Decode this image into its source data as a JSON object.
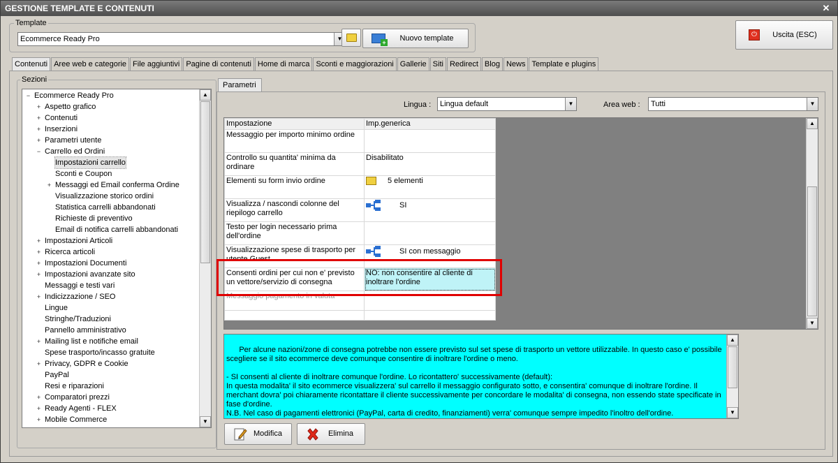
{
  "window": {
    "title": "GESTIONE TEMPLATE E CONTENUTI",
    "close": "✕"
  },
  "template": {
    "legend": "Template",
    "selected": "Ecommerce Ready Pro",
    "new_button": "Nuovo template"
  },
  "exit_button": "Uscita (ESC)",
  "tabs": [
    "Contenuti",
    "Aree web e categorie",
    "File aggiuntivi",
    "Pagine di contenuti",
    "Home di marca",
    "Sconti e maggiorazioni",
    "Gallerie",
    "Siti",
    "Redirect",
    "Blog",
    "News",
    "Template e plugins"
  ],
  "sections": {
    "legend": "Sezioni",
    "items": [
      {
        "label": "Ecommerce Ready Pro",
        "level": 0,
        "exp": "−"
      },
      {
        "label": "Aspetto grafico",
        "level": 1,
        "exp": "+"
      },
      {
        "label": "Contenuti",
        "level": 1,
        "exp": "+"
      },
      {
        "label": "Inserzioni",
        "level": 1,
        "exp": "+"
      },
      {
        "label": "Parametri utente",
        "level": 1,
        "exp": "+"
      },
      {
        "label": "Carrello ed Ordini",
        "level": 1,
        "exp": "−"
      },
      {
        "label": "Impostazioni carrello",
        "level": 2,
        "exp": "",
        "selected": true
      },
      {
        "label": "Sconti e Coupon",
        "level": 2,
        "exp": ""
      },
      {
        "label": "Messaggi ed Email conferma Ordine",
        "level": 2,
        "exp": "+"
      },
      {
        "label": "Visualizzazione storico ordini",
        "level": 2,
        "exp": ""
      },
      {
        "label": "Statistica carrelli abbandonati",
        "level": 2,
        "exp": ""
      },
      {
        "label": "Richieste di preventivo",
        "level": 2,
        "exp": ""
      },
      {
        "label": "Email di notifica carrelli abbandonati",
        "level": 2,
        "exp": ""
      },
      {
        "label": "Impostazioni Articoli",
        "level": 1,
        "exp": "+"
      },
      {
        "label": "Ricerca articoli",
        "level": 1,
        "exp": "+"
      },
      {
        "label": "Impostazioni Documenti",
        "level": 1,
        "exp": "+"
      },
      {
        "label": "Impostazioni avanzate sito",
        "level": 1,
        "exp": "+"
      },
      {
        "label": "Messaggi e testi vari",
        "level": 1,
        "exp": ""
      },
      {
        "label": "Indicizzazione / SEO",
        "level": 1,
        "exp": "+"
      },
      {
        "label": "Lingue",
        "level": 1,
        "exp": ""
      },
      {
        "label": "Stringhe/Traduzioni",
        "level": 1,
        "exp": ""
      },
      {
        "label": "Pannello amministrativo",
        "level": 1,
        "exp": ""
      },
      {
        "label": "Mailing list e notifiche email",
        "level": 1,
        "exp": "+"
      },
      {
        "label": "Spese trasporto/incasso gratuite",
        "level": 1,
        "exp": ""
      },
      {
        "label": "Privacy, GDPR e Cookie",
        "level": 1,
        "exp": "+"
      },
      {
        "label": "PayPal",
        "level": 1,
        "exp": ""
      },
      {
        "label": "Resi e riparazioni",
        "level": 1,
        "exp": ""
      },
      {
        "label": "Comparatori prezzi",
        "level": 1,
        "exp": "+"
      },
      {
        "label": "Ready Agenti - FLEX",
        "level": 1,
        "exp": "+"
      },
      {
        "label": "Mobile Commerce",
        "level": 1,
        "exp": "+"
      }
    ]
  },
  "params": {
    "tab": "Parametri",
    "lingua_label": "Lingua :",
    "lingua_value": "Lingua default",
    "area_label": "Area web :",
    "area_value": "Tutti",
    "headers": [
      "Impostazione",
      "Imp.generica"
    ],
    "rows": [
      {
        "name": "Messaggio per importo minimo ordine",
        "value": "",
        "icon": "",
        "h": 33
      },
      {
        "name": "Controllo su quantita' minima da ordinare",
        "value": "Disabilitato",
        "icon": "",
        "h": 33
      },
      {
        "name": "Elementi su form invio ordine",
        "value": "5 elementi",
        "icon": "folder",
        "h": 33
      },
      {
        "name": "Visualizza / nascondi colonne del riepilogo carrello",
        "value": "SI",
        "icon": "tree",
        "h": 33
      },
      {
        "name": "Testo per login necessario prima dell'ordine",
        "value": "",
        "icon": "",
        "h": 33
      },
      {
        "name": "Visualizzazione spese di trasporto per utente Guest",
        "value": "SI con messaggio",
        "icon": "tree",
        "h": 33
      },
      {
        "name": "Consenti ordini per cui non e' previsto un vettore/servizio di consegna",
        "value": "NO: non consentire al cliente di inoltrare l'ordine",
        "icon": "",
        "h": 33,
        "selected": true
      },
      {
        "name": "Messaggio pagamento in valuta",
        "value": "",
        "icon": "",
        "h": 28
      },
      {
        "name": "",
        "value": "",
        "icon": "",
        "h": 14
      }
    ]
  },
  "description": "Per alcune nazioni/zone di consegna potrebbe non essere previsto sul set spese di trasporto un vettore utilizzabile. In questo caso e' possibile scegliere se il sito ecommerce deve comunque consentire di inoltrare l'ordine o meno.\n\n- SI consenti al cliente di inoltrare comunque l'ordine. Lo ricontattero' successivamente (default):\nIn questa modalita' il sito ecommerce visualizzera' sul carrello il messaggio configurato sotto, e consentira' comunque di inoltrare l'ordine. Il merchant dovra' poi chiaramente ricontattare il cliente successivamente per concordare le modalita' di consegna, non essendo state specificate in fase d'ordine.\nN.B. Nel caso di pagamenti elettronici (PayPal, carta di credito, finanziamenti) verra' comunque sempre impedito l'inoltro dell'ordine.",
  "buttons": {
    "modifica": "Modifica",
    "elimina": "Elimina"
  },
  "colors": {
    "highlight": "#e00000",
    "info_bg": "#00ffff",
    "selected_cell": "#bff3f7"
  }
}
